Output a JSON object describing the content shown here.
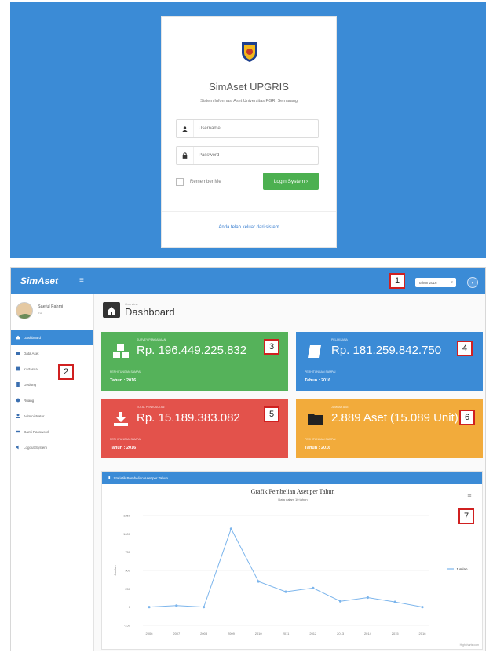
{
  "login": {
    "title": "SimAset UPGRIS",
    "subtitle": "Sistem Informasi Aset Universitas PGRI Semarang",
    "username_placeholder": "Username",
    "password_placeholder": "Password",
    "remember_label": "Remember Me",
    "login_button": "Login System ›",
    "logout_message": "Anda telah keluar dari sistem",
    "colors": {
      "background": "#3b8bd6",
      "button": "#4cb050"
    }
  },
  "dashboard": {
    "brand": "SimAset",
    "toggle_icon": "≡",
    "year_select": "Tahun 2016",
    "profile": {
      "name": "Saeful Fahmi",
      "role": "TU"
    },
    "nav": [
      {
        "label": "Dashboard",
        "icon": "dashboard-icon"
      },
      {
        "label": "Data Aset",
        "icon": "folder-icon"
      },
      {
        "label": "Kartassa",
        "icon": "list-icon"
      },
      {
        "label": "Gedung",
        "icon": "building-icon"
      },
      {
        "label": "Ruang",
        "icon": "door-icon"
      },
      {
        "label": "Administrator",
        "icon": "user-icon"
      },
      {
        "label": "Ganti Password",
        "icon": "key-icon"
      },
      {
        "label": "Logout System",
        "icon": "logout-icon"
      }
    ],
    "breadcrumb": "Overview",
    "page_title": "Dashboard",
    "stats": [
      {
        "label": "SURVEY PENGADAAN",
        "value": "Rp. 196.449.225.832",
        "sub": "PERHITUNGAN SAMPAI",
        "year": "Tahun : 2016",
        "color": "#55b25a",
        "icon": "cubes-icon"
      },
      {
        "label": "PELAKSANA",
        "value": "Rp. 181.259.842.750",
        "sub": "PERHITUNGAN SAMPAI",
        "year": "Tahun : 2016",
        "color": "#3b8bd6",
        "icon": "book-icon"
      },
      {
        "label": "TOTAL PENYUSUTAN",
        "value": "Rp. 15.189.383.082",
        "sub": "PERHITUNGAN SAMPAI",
        "year": "Tahun : 2016",
        "color": "#e3524b",
        "icon": "download-icon"
      },
      {
        "label": "JUMLAH ASET",
        "value": "2.889 Aset (15.089 Unit)",
        "sub": "PERHITUNGAN SAMPAI",
        "year": "Tahun : 2016",
        "color": "#f2ab3b",
        "icon": "folder-icon"
      }
    ],
    "chart_panel_title": "Statistik Pembelian Aset per Tahun",
    "credit": "Highcharts.com"
  },
  "callouts": [
    "1",
    "2",
    "3",
    "4",
    "5",
    "6",
    "7"
  ],
  "chart_data": {
    "type": "line",
    "title": "Grafik Pembelian Aset per Tahun",
    "subtitle": "Data dalam 10 tahun",
    "xlabel": "",
    "ylabel": "Jumlah",
    "categories": [
      "2006",
      "2007",
      "2008",
      "2009",
      "2010",
      "2011",
      "2012",
      "2013",
      "2014",
      "2015",
      "2016"
    ],
    "y_ticks": [
      "-250",
      "0",
      "250",
      "500",
      "750",
      "1000",
      "1250"
    ],
    "ylim": [
      -250,
      1250
    ],
    "series": [
      {
        "name": "Jumlah",
        "values": [
          0,
          20,
          0,
          1070,
          350,
          210,
          260,
          80,
          130,
          70,
          0
        ]
      }
    ],
    "legend": "right",
    "color": "#7cb5ec"
  }
}
